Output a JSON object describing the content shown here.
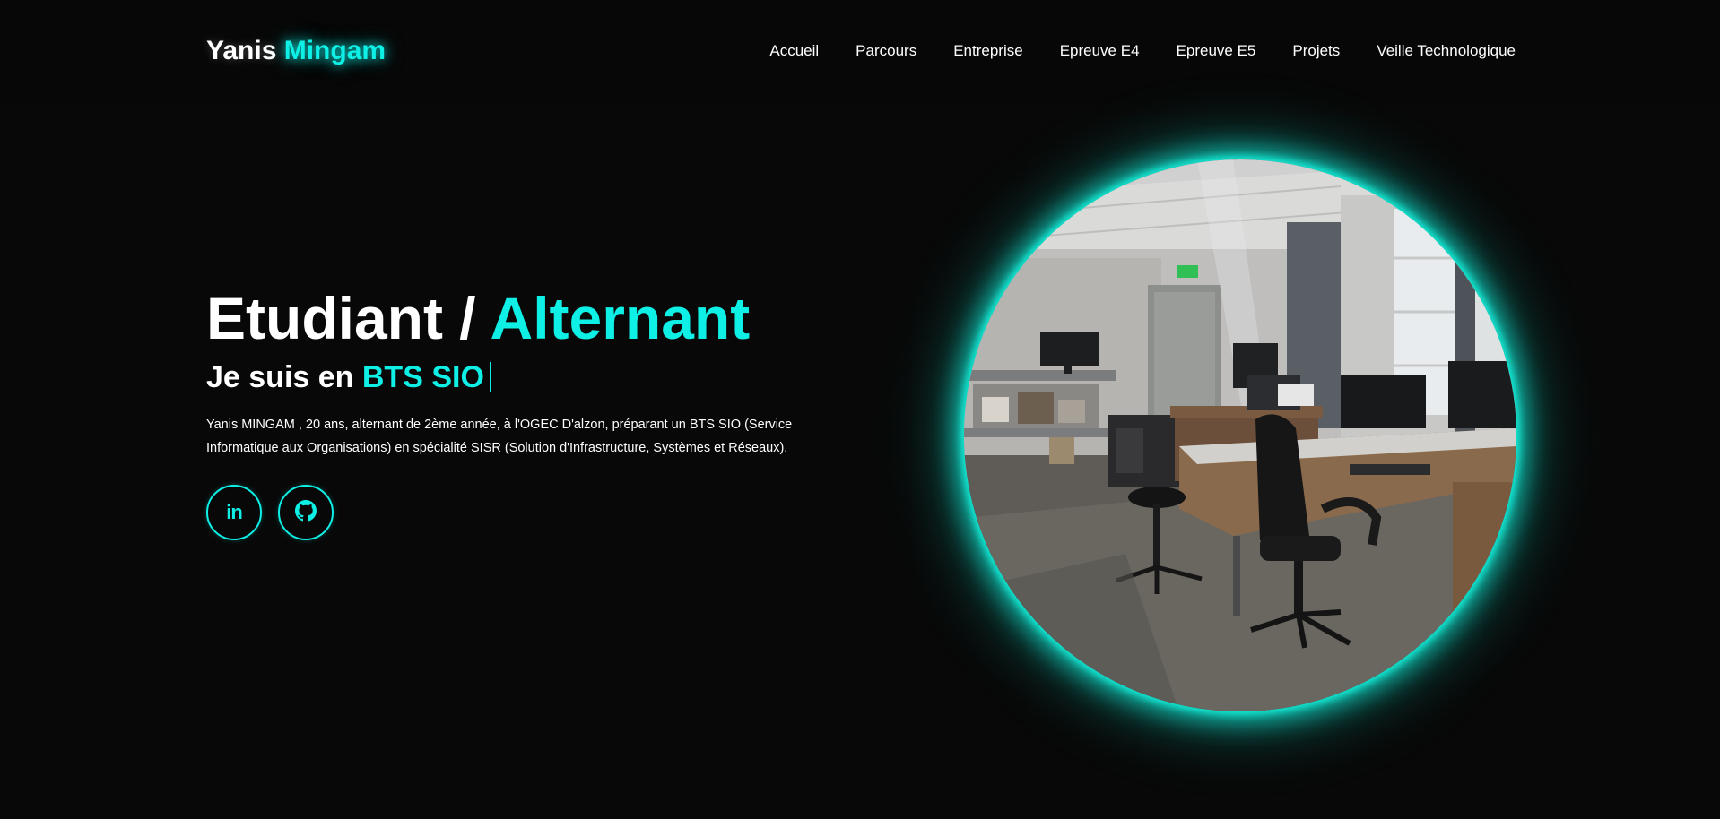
{
  "logo": {
    "first": "Yanis",
    "second": "Mingam"
  },
  "nav": {
    "items": [
      {
        "label": "Accueil"
      },
      {
        "label": "Parcours"
      },
      {
        "label": "Entreprise"
      },
      {
        "label": "Epreuve E4"
      },
      {
        "label": "Epreuve E5"
      },
      {
        "label": "Projets"
      },
      {
        "label": "Veille Technologique"
      }
    ]
  },
  "hero": {
    "title_plain": "Etudiant / ",
    "title_accent": "Alternant",
    "subtitle_plain": "Je suis en ",
    "subtitle_accent": "BTS SIO",
    "description": "Yanis MINGAM , 20 ans, alternant de 2ème année, à l'OGEC D'alzon, préparant un BTS SIO (Service Informatique aux Organisations) en spécialité SISR (Solution d'Infrastructure, Systèmes et Réseaux)."
  },
  "socials": [
    {
      "icon": "linkedin-icon",
      "glyph": "in"
    },
    {
      "icon": "github-icon"
    }
  ],
  "colors": {
    "accent": "#0ef0e6",
    "background": "#080808",
    "text": "#ffffff"
  }
}
